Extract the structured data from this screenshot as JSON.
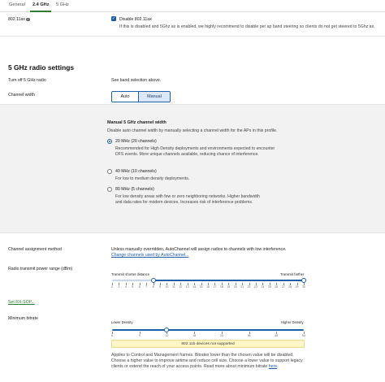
{
  "tabs": [
    {
      "label": "General"
    },
    {
      "label": "2.4 GHz"
    },
    {
      "label": "5 GHz"
    }
  ],
  "disable_80211ax": {
    "row_label": "802.11ax",
    "checkbox_label": "Disable 802.11ax",
    "checked": true,
    "note": "If this is disabled and 5Ghz ax is enabled, we highly recommend to disable per ap band steering so clients do not get steered to 5Ghz ax."
  },
  "section": {
    "title": "5 GHz radio settings"
  },
  "turn_off": {
    "label": "Turn off 5 GHz radio",
    "value": "See band selection above."
  },
  "channel_width": {
    "label": "Channel width",
    "options": [
      "Auto",
      "Manual"
    ],
    "selected": "Manual",
    "panel_title": "Manual 5 GHz channel width",
    "panel_subtitle": "Disable auto channel width by manually selecting a channel width for the APs in this profile.",
    "radios": [
      {
        "label": "20 MHz (20 channels)",
        "checked": true,
        "description": "Recommended for High Density deployments and environments expected to encounter DFS events. More unique channels available, reducing chance of interference."
      },
      {
        "label": "40 MHz (10 channels)",
        "checked": false,
        "description": "For low to medium density deployments."
      },
      {
        "label": "80 MHz (5 channels)",
        "checked": false,
        "description": "For low density areas with few or zero neighboring networks. Higher bandwidth and data rates for modern devices. Increases risk of interference problems."
      }
    ]
  },
  "channel_assignment": {
    "label": "Channel assignment method",
    "text": "Unless manually overridden, AutoChannel will assign radios to channels with low interference.",
    "link": "Change channels used by AutoChannel..."
  },
  "tx_power": {
    "label": "Radio transmit power range (dBm)",
    "left_caption": "Transmit shorter distance",
    "right_caption": "Transmit farther",
    "ticks": [
      "2",
      "3",
      "4",
      "5",
      "6",
      "7",
      "8",
      "9",
      "10",
      "11",
      "12",
      "13",
      "14",
      "15",
      "16",
      "17",
      "18",
      "19",
      "20",
      "21",
      "22",
      "23",
      "24",
      "25",
      "26",
      "27",
      "28",
      "29",
      "30"
    ],
    "min_value": 8,
    "max_value": 30
  },
  "rx_sop": {
    "link": "Set RX-SOP..."
  },
  "min_bitrate": {
    "label": "Minimum bitrate",
    "left_caption": "Lower Density",
    "right_caption": "Higher Density",
    "ticks": [
      "6",
      "9",
      "12",
      "18",
      "24",
      "36",
      "48",
      "54"
    ],
    "selected": "12",
    "warning": "802.11b devices not supported",
    "help_text": "Applies to Control and Management frames. Bitrates lower than the chosen value will be disabled. Choose a higher value to improve airtime and reduce cell size. Choose a lower value to support legacy clients or extend the reach of your access points. Read more about minimum bitrate",
    "help_link": "here"
  },
  "colors": {
    "accent": "#1f5fa8",
    "tab_active": "#2e7d32",
    "warning_bg": "#fff5c6"
  }
}
